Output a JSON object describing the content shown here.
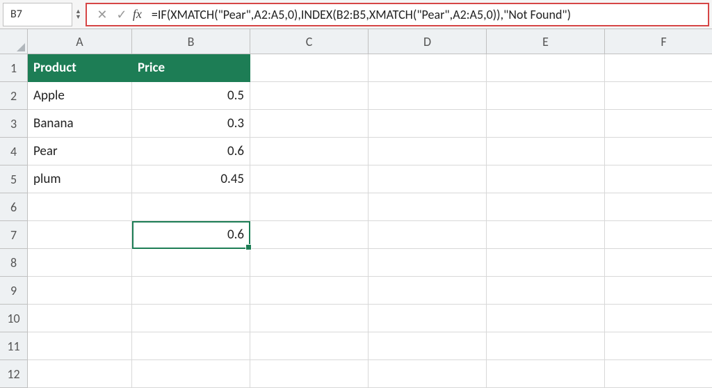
{
  "nameBox": "B7",
  "formula": "=IF(XMATCH(\"Pear\",A2:A5,0),INDEX(B2:B5,XMATCH(\"Pear\",A2:A5,0)),\"Not Found\")",
  "columns": [
    "A",
    "B",
    "C",
    "D",
    "E",
    "F"
  ],
  "rows": [
    "1",
    "2",
    "3",
    "4",
    "5",
    "6",
    "7",
    "8",
    "9",
    "10",
    "11",
    "12"
  ],
  "headers": {
    "A1": "Product",
    "B1": "Price"
  },
  "data": {
    "A2": "Apple",
    "B2": "0.5",
    "A3": "Banana",
    "B3": "0.3",
    "A4": "Pear",
    "B4": "0.6",
    "A5": "plum",
    "B5": "0.45",
    "B7": "0.6"
  },
  "activeCell": "B7",
  "chart_data": {
    "type": "table",
    "title": "",
    "columns": [
      "Product",
      "Price"
    ],
    "rows": [
      [
        "Apple",
        0.5
      ],
      [
        "Banana",
        0.3
      ],
      [
        "Pear",
        0.6
      ],
      [
        "plum",
        0.45
      ]
    ],
    "result": {
      "cell": "B7",
      "value": 0.6,
      "formula": "=IF(XMATCH(\"Pear\",A2:A5,0),INDEX(B2:B5,XMATCH(\"Pear\",A2:A5,0)),\"Not Found\")"
    }
  }
}
